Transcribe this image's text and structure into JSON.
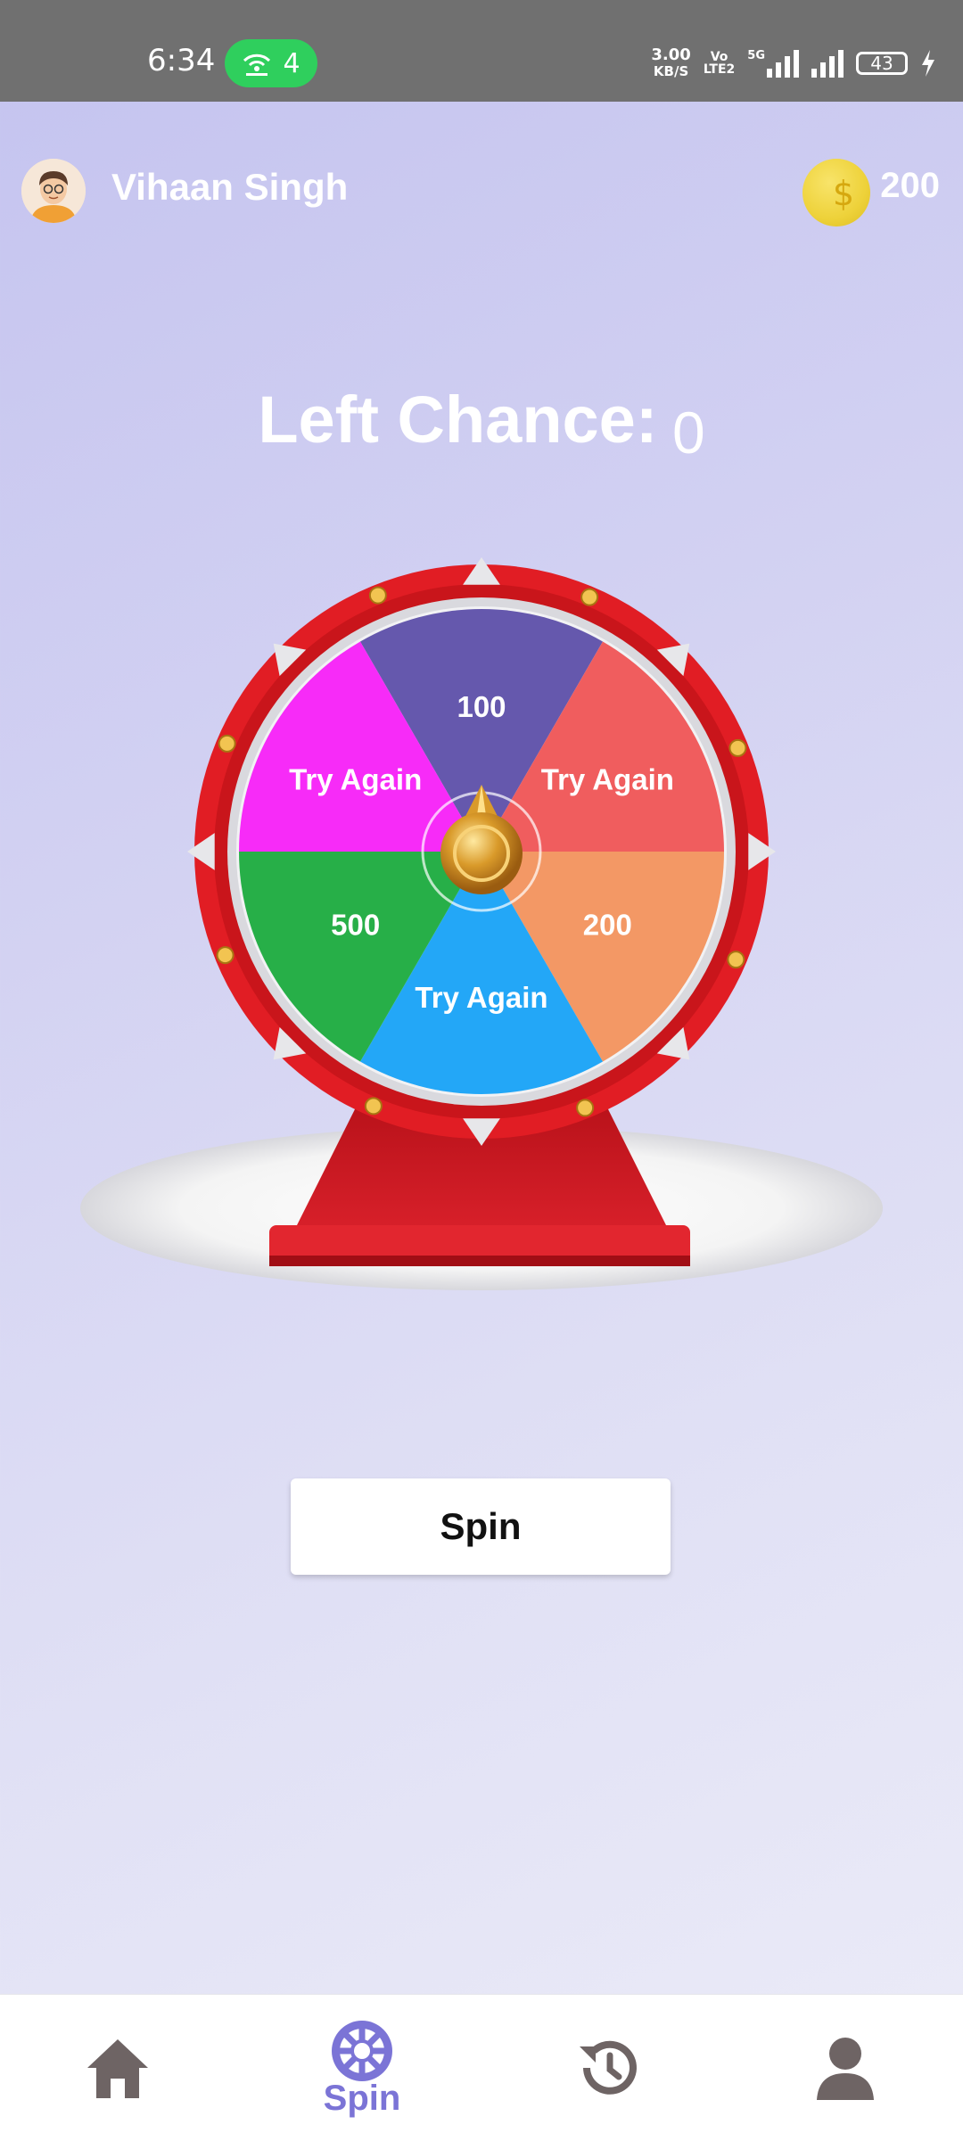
{
  "status_bar": {
    "time": "6:34",
    "hotspot_count": "4",
    "net_speed": "3.00",
    "net_speed_unit": "KB/S",
    "volte_top": "Vo",
    "volte_bottom": "LTE2",
    "net_type": "5G",
    "battery": "43"
  },
  "header": {
    "user_name": "Vihaan Singh",
    "coins": "200"
  },
  "chance": {
    "label": "Left Chance:",
    "count": "0"
  },
  "wheel": {
    "segments": [
      {
        "label": "100",
        "color": "#6558ad"
      },
      {
        "label": "Try Again",
        "color": "#f05d5e"
      },
      {
        "label": "200",
        "color": "#f39865"
      },
      {
        "label": "Try Again",
        "color": "#23a7f7"
      },
      {
        "label": "500",
        "color": "#27af48"
      },
      {
        "label": "Try Again",
        "color": "#f72bf8"
      }
    ],
    "rim_color": "#e11d24",
    "stand_color": "#c8151c"
  },
  "spin_button": {
    "label": "Spin"
  },
  "bottom_nav": {
    "active_label": "Spin",
    "items": [
      {
        "icon": "home-icon"
      },
      {
        "icon": "roulette-icon",
        "label": "Spin"
      },
      {
        "icon": "history-icon"
      },
      {
        "icon": "profile-icon"
      }
    ],
    "accent": "#7b74d6",
    "inactive": "#6e6464"
  }
}
